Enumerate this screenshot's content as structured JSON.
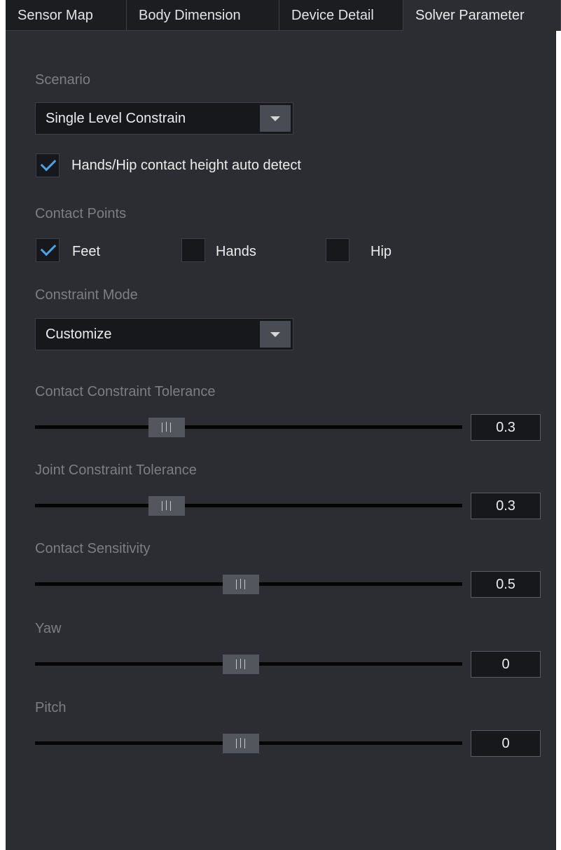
{
  "tabs": [
    {
      "label": "Sensor Map",
      "active": false
    },
    {
      "label": "Body Dimension",
      "active": false
    },
    {
      "label": "Device Detail",
      "active": false
    },
    {
      "label": "Solver Parameter",
      "active": true
    }
  ],
  "scenario": {
    "label": "Scenario",
    "value": "Single Level Constrain",
    "auto_detect": {
      "label": "Hands/Hip contact height auto detect",
      "checked": true
    }
  },
  "contact_points": {
    "label": "Contact Points",
    "options": [
      {
        "label": "Feet",
        "checked": true
      },
      {
        "label": "Hands",
        "checked": false
      },
      {
        "label": "Hip",
        "checked": false
      }
    ]
  },
  "constraint_mode": {
    "label": "Constraint Mode",
    "value": "Customize"
  },
  "sliders": [
    {
      "label": "Contact Constraint Tolerance",
      "value": "0.3",
      "position": 0.29
    },
    {
      "label": "Joint Constraint Tolerance",
      "value": "0.3",
      "position": 0.29
    },
    {
      "label": "Contact Sensitivity",
      "value": "0.5",
      "position": 0.48
    },
    {
      "label": "Yaw",
      "value": "0",
      "position": 0.48
    },
    {
      "label": "Pitch",
      "value": "0",
      "position": 0.48
    }
  ],
  "colors": {
    "panel_bg": "#2c2d33",
    "check_accent": "#4aa3e6"
  }
}
